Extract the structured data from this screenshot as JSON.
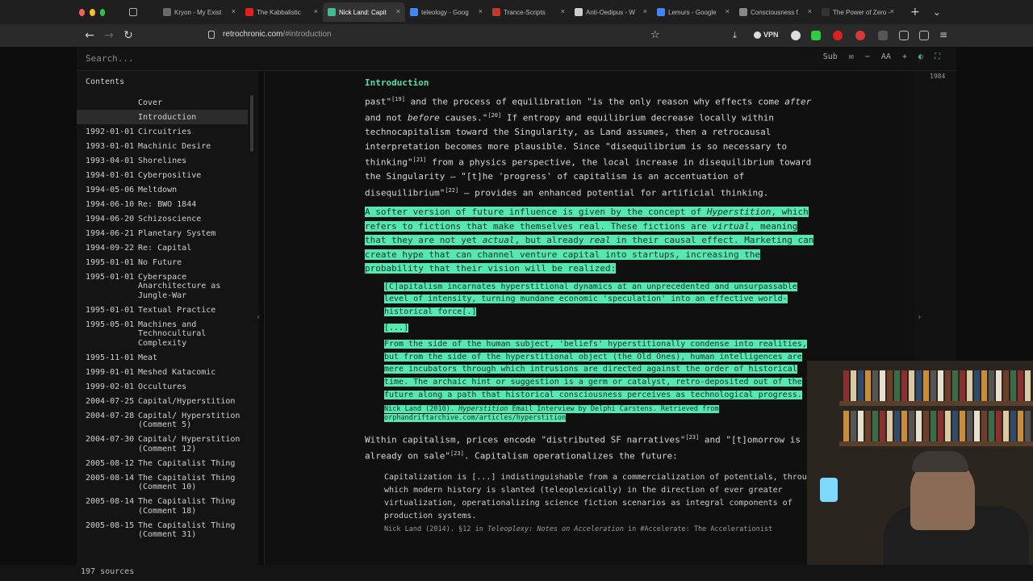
{
  "tabs": [
    {
      "label": "Kryon - My Exist",
      "color": "#6a6a6a"
    },
    {
      "label": "The Kabbalistic",
      "color": "#e02020"
    },
    {
      "label": "Nick Land: Capit",
      "color": "#3fbf8f"
    },
    {
      "label": "teleology - Goog",
      "color": "#4285f4"
    },
    {
      "label": "Trance-Scripts",
      "color": "#c0392b"
    },
    {
      "label": "Anti-Oedipus - W",
      "color": "#cccccc"
    },
    {
      "label": "Lemurs - Google",
      "color": "#4285f4"
    },
    {
      "label": "Consciousness f",
      "color": "#888888"
    },
    {
      "label": "The Power of Zero -",
      "color": "#333333"
    }
  ],
  "tab_close": "×",
  "new_tab": "+",
  "tab_menu": "⌄",
  "url": {
    "domain": "retrochronic.com",
    "path": "/#introduction"
  },
  "vpn": "VPN",
  "app": {
    "search_placeholder": "Search...",
    "sub": "Sub",
    "font_size": "AA",
    "counter": "1984"
  },
  "sidebar": {
    "title": "Contents",
    "items": [
      {
        "date": "",
        "title": "Cover"
      },
      {
        "date": "",
        "title": "Introduction"
      },
      {
        "date": "1992-01-01",
        "title": "Circuitries"
      },
      {
        "date": "1993-01-01",
        "title": "Machinic Desire"
      },
      {
        "date": "1993-04-01",
        "title": "Shorelines"
      },
      {
        "date": "1994-01-01",
        "title": "Cyberpositive"
      },
      {
        "date": "1994-05-06",
        "title": "Meltdown"
      },
      {
        "date": "1994-06-10",
        "title": "Re: BWO 1844"
      },
      {
        "date": "1994-06-20",
        "title": "Schizoscience"
      },
      {
        "date": "1994-06-21",
        "title": "Planetary System"
      },
      {
        "date": "1994-09-22",
        "title": "Re: Capital"
      },
      {
        "date": "1995-01-01",
        "title": "No Future"
      },
      {
        "date": "1995-01-01",
        "title": "Cyberspace Anarchitecture as Jungle-War"
      },
      {
        "date": "1995-01-01",
        "title": "Textual Practice"
      },
      {
        "date": "1995-05-01",
        "title": "Machines and Technocultural Complexity"
      },
      {
        "date": "1995-11-01",
        "title": "Meat"
      },
      {
        "date": "1999-01-01",
        "title": "Meshed Katacomic"
      },
      {
        "date": "1999-02-01",
        "title": "Occultures"
      },
      {
        "date": "2004-07-25",
        "title": "Capital/Hyperstition"
      },
      {
        "date": "2004-07-28",
        "title": "Capital/ Hyperstition (Comment 5)"
      },
      {
        "date": "2004-07-30",
        "title": "Capital/ Hyperstition (Comment 12)"
      },
      {
        "date": "2005-08-12",
        "title": "The Capitalist Thing"
      },
      {
        "date": "2005-08-14",
        "title": "The Capitalist Thing (Comment 10)"
      },
      {
        "date": "2005-08-14",
        "title": "The Capitalist Thing (Comment 18)"
      },
      {
        "date": "2005-08-15",
        "title": "The Capitalist Thing (Comment 31)"
      }
    ],
    "active_index": 1,
    "footer": "197 sources"
  },
  "main": {
    "section_title": "Introduction",
    "p1": {
      "a": "past\"",
      "s1": "[19]",
      "b": " and the process of equilibration \"is the only reason why effects come ",
      "i1": "after",
      "c": " and not ",
      "i2": "before",
      "d": " causes.\"",
      "s2": "[20]",
      "e": " If entropy and equilibrium decrease locally within technocapitalism toward the Singularity, as Land assumes, then a retrocausal interpretation becomes more plausible. Since \"disequilibrium is so necessary to thinking\"",
      "s3": "[21]",
      "f": " from a physics perspective, the local increase in disequilibrium toward the Singularity — \"[t]he 'progress' of capitalism is an accentuation of disequilibrium\"",
      "s4": "[22]",
      "g": " — provides an enhanced potential for artificial thinking."
    },
    "p2": {
      "a": "A softer version of future influence is given by the concept of ",
      "i1": "Hyperstition",
      "b": ", which refers to fictions that make themselves real. These fictions are ",
      "i2": "virtual",
      "c": ", meaning that they are not yet ",
      "i3": "actual",
      "d": ", but already ",
      "i4": "real",
      "e": " in their causal effect. Marketing can create hype that can channel venture capital into startups, increasing the probability that their vision will be realized:"
    },
    "q1": "[C]apitalism incarnates hyperstitional dynamics at an unprecedented and unsurpassable level of intensity, turning mundane economic 'speculation' into an effective world-historical force[.]",
    "q1_ellipsis": "[...]",
    "q2": "From the side of the human subject, 'beliefs' hyperstitionally condense into realities, but from the side of the hyperstitional object (the Old Ones), human intelligences are mere incubators through which intrusions are directed against the order of historical time. The archaic hint or suggestion is a germ or catalyst, retro-deposited out of the future along a path that historical consciousness perceives as technological progress.",
    "cite1": {
      "a": "Nick Land (2010). ",
      "i": "Hyperstition",
      "b": " Email Interview by Delphi Carstens. Retrieved from orphandriftarchive.com/articles/hyperstition"
    },
    "p3": {
      "a": "Within capitalism, prices encode \"distributed SF narratives\"",
      "s1": "[23]",
      "b": " and \"[t]omorrow is already on sale\"",
      "s2": "[23]",
      "c": ". Capitalism operationalizes the future:"
    },
    "q3": "Capitalization is [...] indistinguishable from a commercialization of potentials, through which modern history is slanted (teleoplexically) in the direction of ever greater virtualization, operationalizing science fiction scenarios as integral components of production systems.",
    "cite2": {
      "a": "Nick Land (2014). §12 in ",
      "i": "Teleoplexy: Notes on Acceleration",
      "b": " in #Accelerate: The Accelerationist"
    }
  },
  "colors": {
    "accent": "#4fe0a7",
    "highlight": "#55e8b0"
  }
}
